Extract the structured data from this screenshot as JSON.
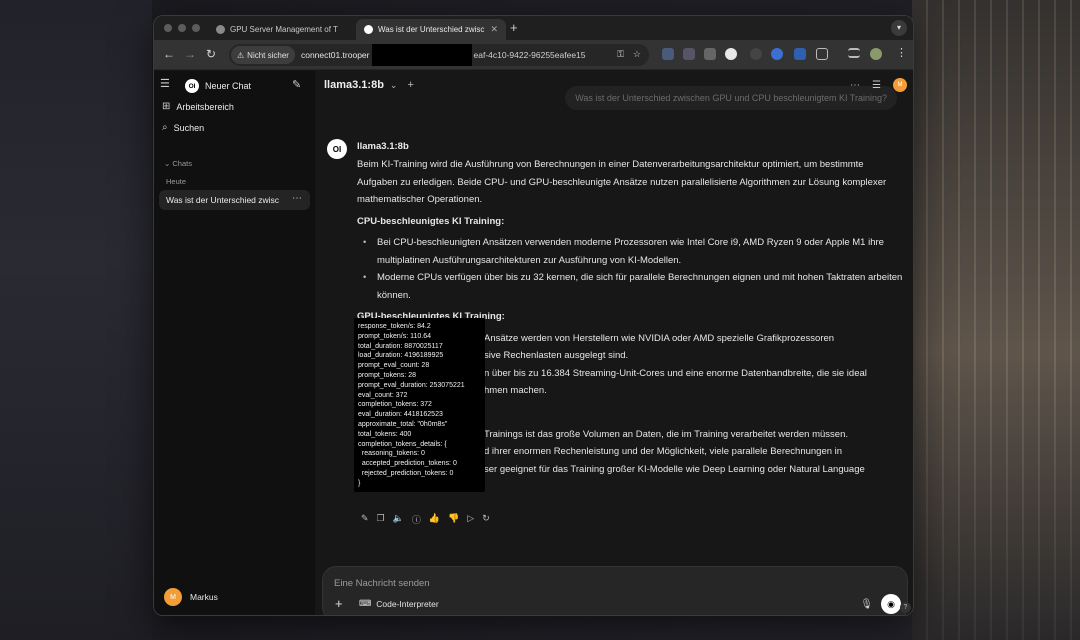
{
  "browser": {
    "tabs": [
      {
        "title": "GPU Server Management of T",
        "active": false
      },
      {
        "title": "Was ist der Unterschied zwisc",
        "active": true
      }
    ],
    "new_tab": "+",
    "security_chip": "Nicht sicher",
    "url_start": "connect01.trooper",
    "url_end": "eaf-4c10-9422-96255eafee15"
  },
  "sidebar": {
    "new_chat": "Neuer Chat",
    "workspace": "Arbeitsbereich",
    "search": "Suchen",
    "chats_label": "Chats",
    "today_label": "Heute",
    "chat_item": "Was ist der Unterschied zwisc",
    "user_name": "Markus",
    "user_initial": "M"
  },
  "main": {
    "model": "llama3.1:8b",
    "user_message": "Was ist der Unterschied zwischen GPU und CPU beschleunigtem KI Training?",
    "bot_name": "llama3.1:8b",
    "bot_logo": "OI",
    "p1": "Beim KI-Training wird die Ausführung von Berechnungen in einer Datenverarbeitungsarchitektur optimiert, um bestimmte Aufgaben zu erledigen. Beide CPU- und GPU-beschleunigte Ansätze nutzen parallelisierte Algorithmen zur Lösung komplexer mathematischer Operationen.",
    "h_cpu": "CPU-beschleunigtes KI Training:",
    "cpu_b1": "Bei CPU-beschleunigten Ansätzen verwenden moderne Prozessoren wie Intel Core i9, AMD Ryzen 9 oder Apple M1 ihre multiplatinen Ausführungsarchitekturen zur Ausführung von KI-Modellen.",
    "cpu_b2": "Moderne CPUs verfügen über bis zu 32 kernen, die sich für parallele Berechnungen eignen und mit hohen Taktraten arbeiten können.",
    "h_gpu": "GPU-beschleunigtes KI Training:",
    "gpu_b1": "Ansätze werden von Herstellern wie NVIDIA oder AMD spezielle Grafikprozessoren",
    "gpu_b1b": "sive Rechenlasten ausgelegt sind.",
    "gpu_b2": "n über bis zu 16.384 Streaming-Unit-Cores und eine enorme Datenbandbreite, die sie ideal",
    "gpu_b2b": "hmen machen.",
    "p_end1": "Trainings ist das große Volumen an Daten, die im Training verarbeitet werden müssen.",
    "p_end2": "d ihrer enormen Rechenleistung und der Möglichkeit, viele parallele Berechnungen in",
    "p_end3": "ser geeignet für das Training großer KI-Modelle wie Deep Learning oder Natural Language",
    "tooltip": "response_token/s: 84.2\nprompt_token/s: 110.64\ntotal_duration: 8870025117\nload_duration: 4196189925\nprompt_eval_count: 28\nprompt_tokens: 28\nprompt_eval_duration: 253075221\neval_count: 372\ncompletion_tokens: 372\neval_duration: 4418162523\napproximate_total: \"0h0m8s\"\ntotal_tokens: 400\ncompletion_tokens_details: {\n  reasoning_tokens: 0\n  accepted_prediction_tokens: 0\n  rejected_prediction_tokens: 0\n}"
  },
  "composer": {
    "placeholder": "Eine Nachricht senden",
    "code_interpreter": "Code-Interpreter",
    "help": "?"
  }
}
